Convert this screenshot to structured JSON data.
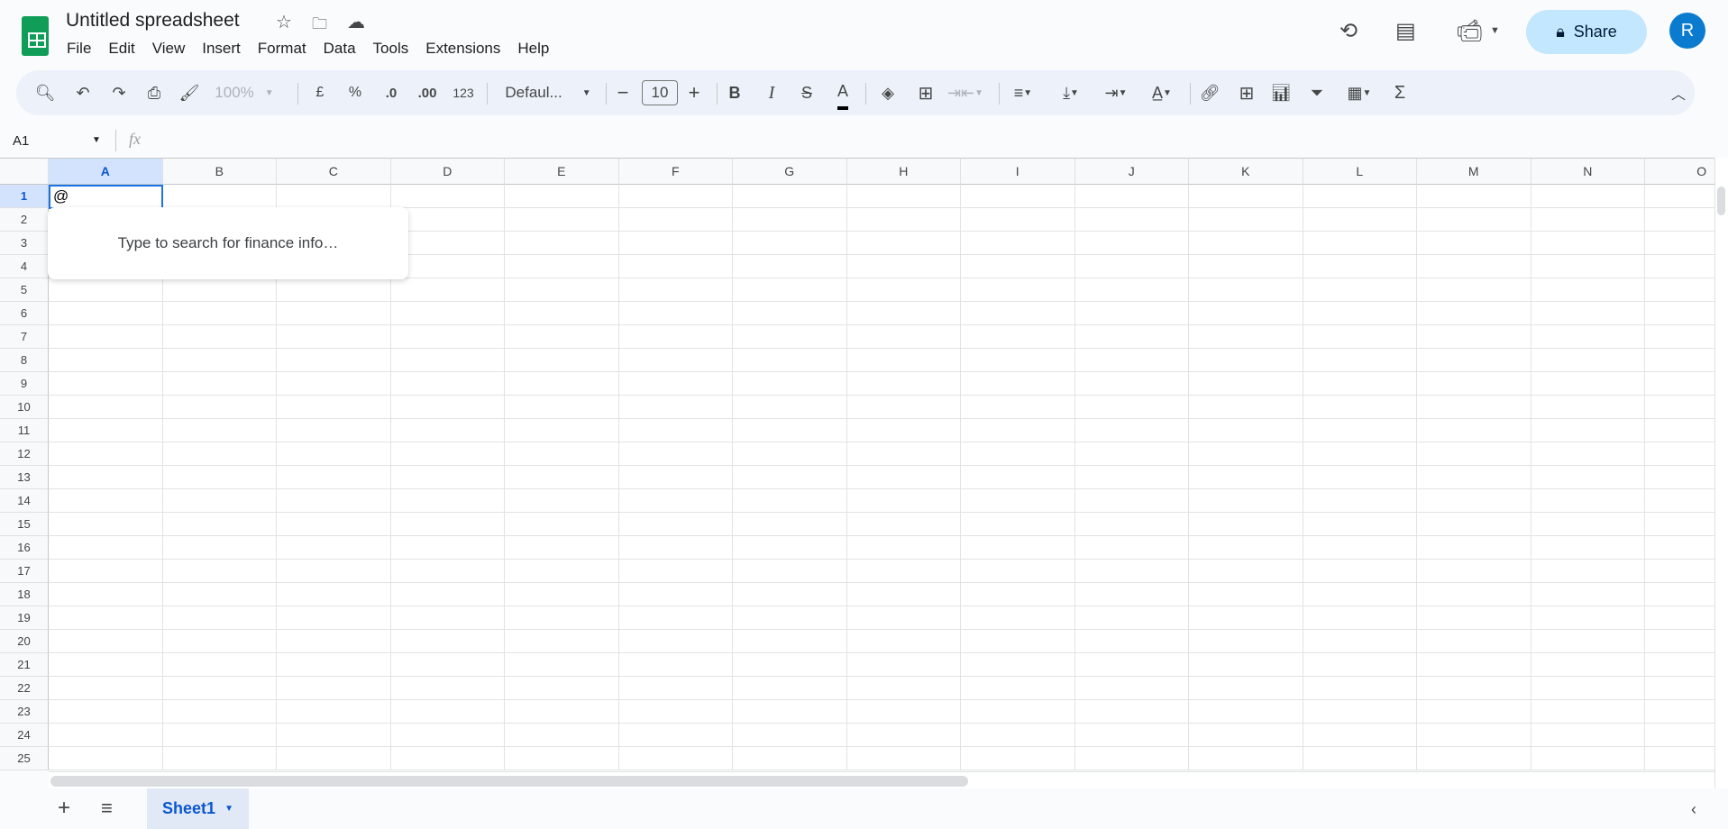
{
  "app": {
    "title": "Untitled spreadsheet",
    "icons": [
      "star-icon",
      "move-folder-icon",
      "cloud-saved-icon"
    ]
  },
  "menu": [
    "File",
    "Edit",
    "View",
    "Insert",
    "Format",
    "Data",
    "Tools",
    "Extensions",
    "Help"
  ],
  "header": {
    "share_label": "Share",
    "avatar_letter": "R",
    "share_color": "#c2e7ff",
    "avatar_color": "#0b7bd0"
  },
  "toolbar": {
    "zoom": "100%",
    "currency": "£",
    "percent": "%",
    "decrease_decimal": ".0",
    "increase_decimal": ".00",
    "more_formats": "123",
    "font": "Defaul...",
    "font_size": "10",
    "bold": "B",
    "italic": "I"
  },
  "formula_bar": {
    "name_box": "A1",
    "fx": "fx",
    "value": ""
  },
  "grid": {
    "columns": [
      "A",
      "B",
      "C",
      "D",
      "E",
      "F",
      "G",
      "H",
      "I",
      "J",
      "K",
      "L",
      "M",
      "N",
      "O"
    ],
    "rows": [
      "1",
      "2",
      "3",
      "4",
      "5",
      "6",
      "7",
      "8",
      "9",
      "10",
      "11",
      "12",
      "13",
      "14",
      "15",
      "16",
      "17",
      "18",
      "19",
      "20",
      "21",
      "22",
      "23",
      "24",
      "25"
    ],
    "active_cell": "A1",
    "active_value": "@"
  },
  "popup": {
    "text": "Type to search for finance info…"
  },
  "sheets": {
    "tabs": [
      "Sheet1"
    ]
  }
}
